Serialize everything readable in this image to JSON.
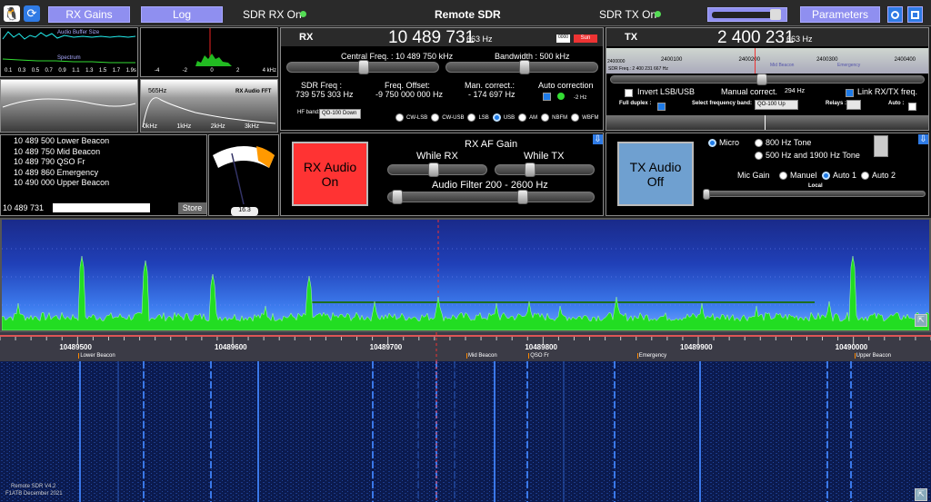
{
  "topbar": {
    "rx_gains": "RX Gains",
    "log": "Log",
    "sdr_rx_status": "SDR RX On",
    "title": "Remote SDR",
    "sdr_tx_status": "SDR TX On",
    "parameters": "Parameters",
    "volume_level": 0.85
  },
  "left": {
    "audio_buffer_label": "Audio Buffer Size",
    "spectrum_label": "Spectrum",
    "scale1": [
      "0.1",
      "0.3",
      "0.5",
      "0.7",
      "0.9",
      "1.1",
      "1.3",
      "1.5",
      "1.7",
      "1.9s"
    ],
    "scale2": [
      "-4",
      "-2",
      "0",
      "2",
      "4 kHz"
    ],
    "hz_label": "565Hz",
    "rx_audio_fft": "RX Audio FFT",
    "fft_scale": [
      "0kHz",
      "1kHz",
      "2kHz",
      "3kHz"
    ],
    "memories": [
      "10 489 500 Lower Beacon",
      "10 489 750 Mid Beacon",
      "10 489 790 QSO Fr",
      "10 489 860 Emergency",
      "10 490 000 Upper Beacon"
    ],
    "current_freq": "10 489 731",
    "store": "Store",
    "smeter_value": "16.3"
  },
  "rx": {
    "label": "RX",
    "freq_main": "10 489 731",
    "freq_hz": "663 Hz",
    "sun_btn": "Sun",
    "central_freq": "Central Freq. : 10 489 750 kHz",
    "bandwidth": "Bandwidth : 500 kHz",
    "sdr_freq_label": "SDR Freq :",
    "sdr_freq_value": "739 575 303 Hz",
    "freq_offset_label": "Freq. Offset:",
    "freq_offset_value": "-9 750 000 000 Hz",
    "man_correct_label": "Man. correct.:",
    "man_correct_value": "- 174 697 Hz",
    "auto_correction": "Auto correction",
    "auto_corr_value": "-2 Hz",
    "hf_band_label": "HF band:",
    "hf_band_value": "QO-100 Down",
    "modes": [
      "CW-LSB",
      "CW-USB",
      "LSB",
      "USB",
      "AM",
      "NBFM",
      "WBFM"
    ],
    "selected_mode": "USB",
    "audio_btn": "RX Audio On",
    "af_gain": "RX AF Gain",
    "while_rx": "While RX",
    "while_tx": "While TX",
    "audio_filter": "Audio Filter 200 - 2600 Hz"
  },
  "tx": {
    "label": "TX",
    "freq_main": "2 400 231",
    "freq_hz": "663 Hz",
    "scale": [
      "2400100",
      "2400200",
      "2400300",
      "2400400"
    ],
    "tick_start": "2400000",
    "sdr_freq": "SDR Freq.: 2 400 231 667 Hz",
    "mid_beacon": "Mid Beacon",
    "emergency": "Emergency",
    "invert": "Invert LSB/USB",
    "manual_correct": "Manual correct.",
    "manual_value": "294 Hz",
    "link": "Link RX/TX freq.",
    "full_duplex": "Full duplex :",
    "select_band": "Select frequency band:",
    "band_value": "QO-100 Up",
    "relays": "Relays :",
    "auto": "Auto :",
    "audio_btn": "TX Audio Off",
    "micro": "Micro",
    "tone800": "800 Hz Tone",
    "tone500": "500 Hz and 1900 Hz Tone",
    "mic_gain": "Mic Gain",
    "manuel": "Manuel",
    "auto1": "Auto 1",
    "auto2": "Auto 2",
    "local": "Local"
  },
  "waterfall": {
    "ticks": [
      "10489500",
      "10489600",
      "10489700",
      "10489800",
      "10489900",
      "10490000"
    ],
    "markers": [
      "Lower Beacon",
      "Mid Beacon",
      "QSO Fr",
      "Emergency",
      "Upper Beacon"
    ],
    "version": "Remote SDR V4.2",
    "copyright": "F1ATB December 2021"
  },
  "colors": {
    "accent": "#8f8ff0",
    "rx_btn": "#f03030",
    "tx_btn": "#6fa0d0",
    "spectrum": "#22dd22"
  }
}
